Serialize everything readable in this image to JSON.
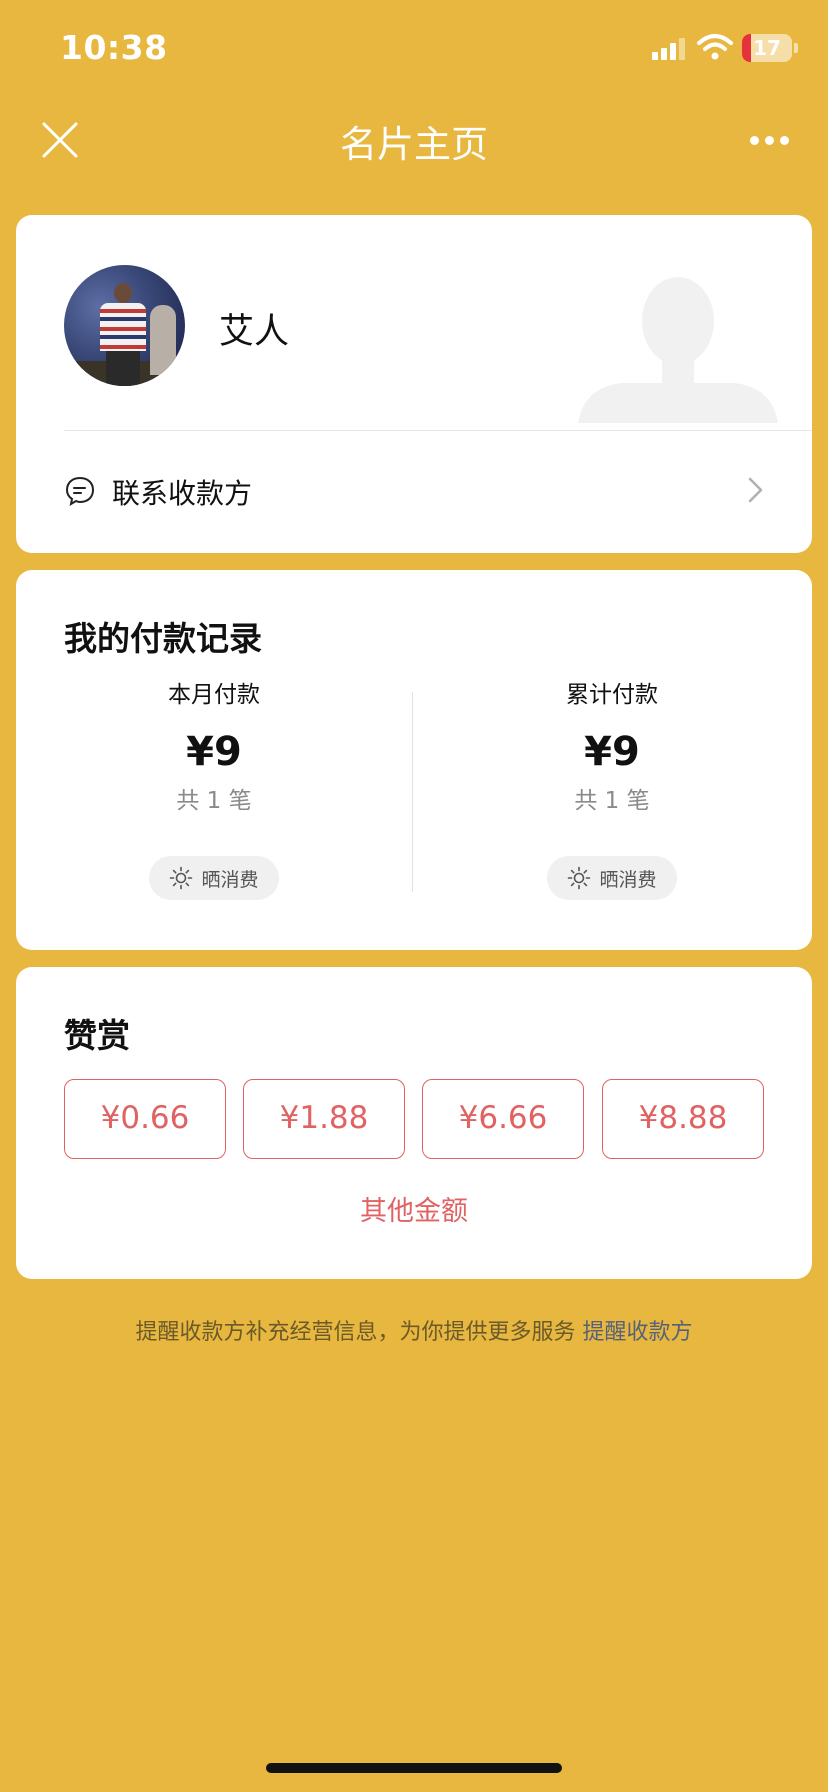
{
  "status_bar": {
    "time": "10:38",
    "battery_level": "17",
    "icons": [
      "signal-icon",
      "wifi-icon",
      "battery-icon"
    ]
  },
  "nav": {
    "title": "名片主页",
    "left_icon": "close-icon",
    "right_icon": "more-icon"
  },
  "profile": {
    "name": "艾人",
    "contact_label": "联系收款方",
    "contact_icon": "chat-bubble-icon"
  },
  "payments": {
    "title": "我的付款记录",
    "this_month": {
      "label": "本月付款",
      "amount": "¥9",
      "count": "共 1 笔",
      "button_label": "晒消费"
    },
    "total": {
      "label": "累计付款",
      "amount": "¥9",
      "count": "共 1 笔",
      "button_label": "晒消费"
    }
  },
  "tip": {
    "title": "赞赏",
    "amounts": [
      "¥0.66",
      "¥1.88",
      "¥6.66",
      "¥8.88"
    ],
    "other_label": "其他金额"
  },
  "footer": {
    "note": "提醒收款方补充经营信息，为你提供更多服务",
    "link_label": "提醒收款方"
  },
  "colors": {
    "background": "#E8B73F",
    "accent_red": "#E06262",
    "link": "#56627a"
  }
}
